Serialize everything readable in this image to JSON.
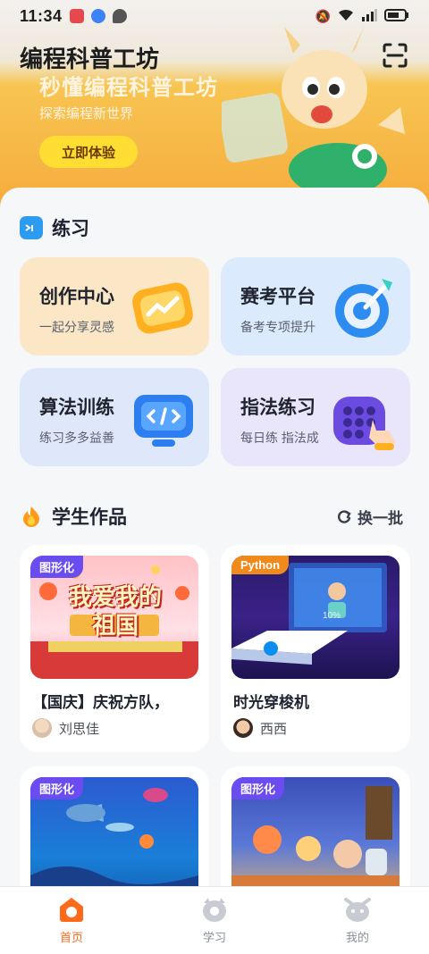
{
  "status_bar": {
    "time": "11:34"
  },
  "header": {
    "title": "编程科普工坊",
    "scan_icon": "scan-icon"
  },
  "banner": {
    "headline": "秒懂编程科普工坊",
    "subtitle": "探索编程新世界",
    "cta_label": "立即体验"
  },
  "practice": {
    "title": "练习",
    "cards": [
      {
        "title": "创作中心",
        "subtitle": "一起分享灵感",
        "bg": "#fbe7c6"
      },
      {
        "title": "赛考平台",
        "subtitle": "备考专项提升",
        "bg": "#dceafe"
      },
      {
        "title": "算法训练",
        "subtitle": "练习多多益善",
        "bg": "#dfe8fb"
      },
      {
        "title": "指法练习",
        "subtitle": "每日练 指法成",
        "bg": "#e9e6fb"
      }
    ]
  },
  "works": {
    "title": "学生作品",
    "refresh_label": "换一批",
    "items": [
      {
        "tag": "图形化",
        "tag_color": "#6a4cf0",
        "thumb_text": "我爱我的祖国",
        "title": "【国庆】庆祝方队，",
        "author": "刘思佳"
      },
      {
        "tag": "Python",
        "tag_color": "#f08a1c",
        "thumb_text": "10%",
        "title": "时光穿梭机",
        "author": "西西"
      },
      {
        "tag": "图形化",
        "tag_color": "#6a4cf0",
        "title": "",
        "author": ""
      },
      {
        "tag": "图形化",
        "tag_color": "#6a4cf0",
        "title": "",
        "author": ""
      }
    ]
  },
  "nav": {
    "items": [
      {
        "label": "首页",
        "active": true
      },
      {
        "label": "学习",
        "active": false
      },
      {
        "label": "我的",
        "active": false
      }
    ]
  },
  "colors": {
    "accent": "#ff6a1a",
    "cta": "#ffdd33"
  }
}
